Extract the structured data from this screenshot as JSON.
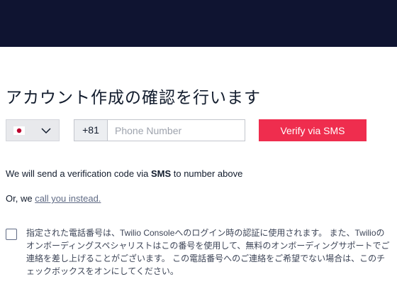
{
  "header": {
    "bg_color": "#0f1431"
  },
  "page": {
    "title": "アカウント作成の確認を行います"
  },
  "country_selector": {
    "flag_icon": "japan-flag-icon",
    "chevron_icon": "chevron-down-icon"
  },
  "phone": {
    "country_code": "+81",
    "placeholder": "Phone Number",
    "value": ""
  },
  "verify_button": {
    "label": "Verify via SMS",
    "color": "#ef2d4e"
  },
  "info": {
    "before": "We will send a verification code via ",
    "bold": "SMS",
    "after": " to number above"
  },
  "alternative": {
    "prefix": "Or, we ",
    "link": "call you instead."
  },
  "consent": {
    "checked": false,
    "text": "指定された電話番号は、Twilio Consoleへのログイン時の認証に使用されます。 また、Twilioのオンボーディングスペシャリストはこの番号を使用して、無料のオンボーディングサポートでご連絡を差し上げることがございます。 この電話番号へのご連絡をご希望でない場合は、このチェックボックスをオンにしてください。"
  }
}
